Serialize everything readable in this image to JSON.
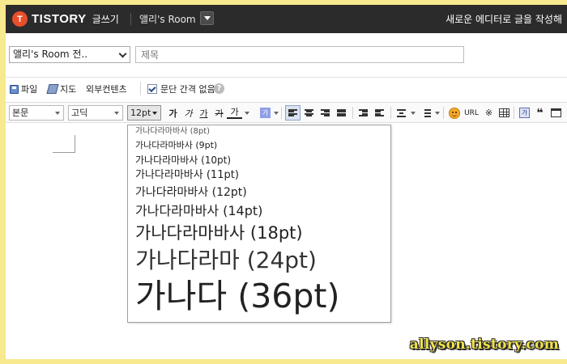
{
  "header": {
    "logo_mark": "T",
    "logo_text": "TISTORY",
    "mode_label": "글쓰기",
    "blog_name": "앨리's Room",
    "new_editor_text": "새로운 에디터로 글을 작성해"
  },
  "post": {
    "category_value": "앨리's Room 전..",
    "title_placeholder": "제목"
  },
  "attach": {
    "file_label": "파일",
    "map_label": "지도",
    "external_label": "외부컨텐츠",
    "paragraph_label": "문단 간격 없음",
    "paragraph_checked": true,
    "help_label": "?"
  },
  "toolbar": {
    "paragraph_style": "본문",
    "font_family": "고딕",
    "font_size": "12pt",
    "bold": "가",
    "italic": "가",
    "underline": "가",
    "strike": "가",
    "text_color": "가",
    "bg_color": "가",
    "url_label": "URL",
    "special_char": "※",
    "box_label": "가",
    "quote_label": "❝"
  },
  "font_size_options": [
    {
      "label": "가나다라마바사 (8pt)",
      "size": 8
    },
    {
      "label": "가나다라마바사 (9pt)",
      "size": 9
    },
    {
      "label": "가나다라마바사 (10pt)",
      "size": 10
    },
    {
      "label": "가나다라마바사 (11pt)",
      "size": 11
    },
    {
      "label": "가나다라마바사 (12pt)",
      "size": 12
    },
    {
      "label": "가나다라마바사 (14pt)",
      "size": 14
    },
    {
      "label": "가나다라마바사 (18pt)",
      "size": 18
    },
    {
      "label": "가나다라마 (24pt)",
      "size": 24
    },
    {
      "label": "가나다 (36pt)",
      "size": 36
    }
  ],
  "watermark": "allyson.tistory.com",
  "colors": {
    "topbar": "#2b2b2b",
    "logo_accent": "#e94e2b",
    "page_background": "#f7e98e",
    "watermark": "#f0e24a"
  }
}
